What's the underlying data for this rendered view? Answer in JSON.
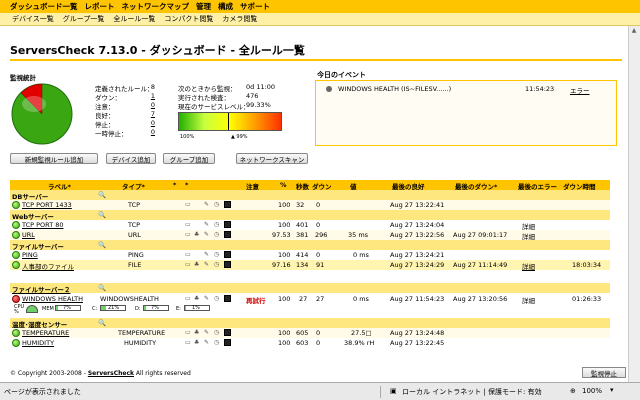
{
  "menu": [
    "ダッシュボード一覧",
    "レポート",
    "ネットワークマップ",
    "管理",
    "構成",
    "サポート"
  ],
  "submenu": [
    "デバイス一覧",
    "グループ一覧",
    "全ルール一覧",
    "コンパクト閲覧",
    "カメラ閲覧"
  ],
  "title": "ServersCheck 7.13.0 - ダッシュボード - 全ルール一覧",
  "stats": {
    "heading": "監視統計",
    "labels": [
      "定義されたルール：",
      "ダウン：",
      "注意：",
      "良好：",
      "停止：",
      "一時停止："
    ],
    "values": [
      "8",
      "1",
      "0",
      "7",
      "0",
      "0"
    ],
    "right_labels": [
      "次のときから監視：",
      "実行された検査：",
      "現在のサービスレベル："
    ],
    "right_values": [
      "0d 11:00",
      "476",
      "99.33%"
    ],
    "gauge_left": "100%",
    "gauge_right": "▲ 99%",
    "service_level": 0.9933,
    "colors": {
      "ok": "#3aa612",
      "down": "#e00000"
    }
  },
  "events": {
    "heading": "今日のイベント",
    "text": "WINDOWS HEALTH (IS~FILESV......)",
    "time": "11:54:23",
    "status": "エラー"
  },
  "buttons": [
    "新規監視ルール追加",
    "デバイス追加",
    "グループ追加",
    "ネットワークスキャン"
  ],
  "table": {
    "headers": [
      "ラベル*",
      "タイプ*",
      "*",
      "*",
      "注意",
      "%",
      "秒数",
      "ダウン",
      "値",
      "最後の良好",
      "最後のダウン*",
      "最後のエラー",
      "ダウン時間"
    ],
    "groups": [
      "DBサーバー",
      "Webサーバー",
      "ファイルサーバー",
      "ファイルサーバー２",
      "温度･湿度センサー"
    ],
    "rows": [
      {
        "label": "TCP PORT 1433",
        "type": "TCP",
        "warn": "",
        "pct": "100",
        "sec": "32",
        "down": "0",
        "value": "",
        "good": "Aug 27 13:22:41",
        "lastdown": "",
        "err": "",
        "downtime": ""
      },
      {
        "label": "TCP PORT 80",
        "type": "TCP",
        "warn": "",
        "pct": "100",
        "sec": "401",
        "down": "0",
        "value": "",
        "good": "Aug 27 13:24:04",
        "lastdown": "",
        "err": "詳細",
        "downtime": ""
      },
      {
        "label": "URL",
        "type": "URL",
        "warn": "",
        "pct": "97.53",
        "sec": "381",
        "down": "296",
        "value": "35 ms",
        "good": "Aug 27 13:22:56",
        "lastdown": "Aug 27 09:01:17",
        "err": "詳細",
        "downtime": ""
      },
      {
        "label": "PING",
        "type": "PING",
        "warn": "",
        "pct": "100",
        "sec": "414",
        "down": "0",
        "value": "0 ms",
        "good": "Aug 27 13:24:21",
        "lastdown": "",
        "err": "",
        "downtime": ""
      },
      {
        "label": "人事部のファイル",
        "type": "FILE",
        "warn": "",
        "pct": "97.16",
        "sec": "134",
        "down": "91",
        "value": "",
        "good": "Aug 27 13:24:29",
        "lastdown": "Aug 27 11:14:49",
        "err": "詳細",
        "downtime": "18:03:34"
      },
      {
        "label": "WINDOWS HEALTH",
        "type": "WINDOWSHEALTH",
        "warn": "再試行",
        "pct": "100",
        "sec": "27",
        "down": "27",
        "value": "0 ms",
        "good": "Aug 27 11:54:23",
        "lastdown": "Aug 27 13:20:56",
        "err": "詳細",
        "downtime": "01:26:33"
      },
      {
        "label": "TEMPERATURE",
        "type": "TEMPERATURE",
        "warn": "",
        "pct": "100",
        "sec": "605",
        "down": "0",
        "value": "27.5□",
        "good": "Aug 27 13:24:48",
        "lastdown": "",
        "err": "",
        "downtime": ""
      },
      {
        "label": "HUMIDITY",
        "type": "HUMIDITY",
        "warn": "",
        "pct": "100",
        "sec": "603",
        "down": "0",
        "value": "38.9% rH",
        "good": "Aug 27 13:22:45",
        "lastdown": "",
        "err": "",
        "downtime": ""
      }
    ],
    "health": {
      "cpu_label": "CPU",
      "cpu_value": "%",
      "mem_label": "MEM",
      "mem_value": "7%",
      "c_label": "C:",
      "c_value": "21%",
      "d_label": "D:",
      "d_value": "7%",
      "e_label": "E:",
      "e_value": "1%",
      "mem_fill": 0.07,
      "c_fill": 0.21,
      "d_fill": 0.07,
      "e_fill": 0.01
    }
  },
  "footer": {
    "copyright": "© Copyright 2003-2008 -",
    "brand": "ServersCheck",
    "rights": "All rights reserved",
    "stop": "監視停止"
  },
  "status": {
    "left": "ページが表示されました",
    "zone": "ローカル イントラネット | 保護モード: 有効",
    "zoom": "100%"
  }
}
